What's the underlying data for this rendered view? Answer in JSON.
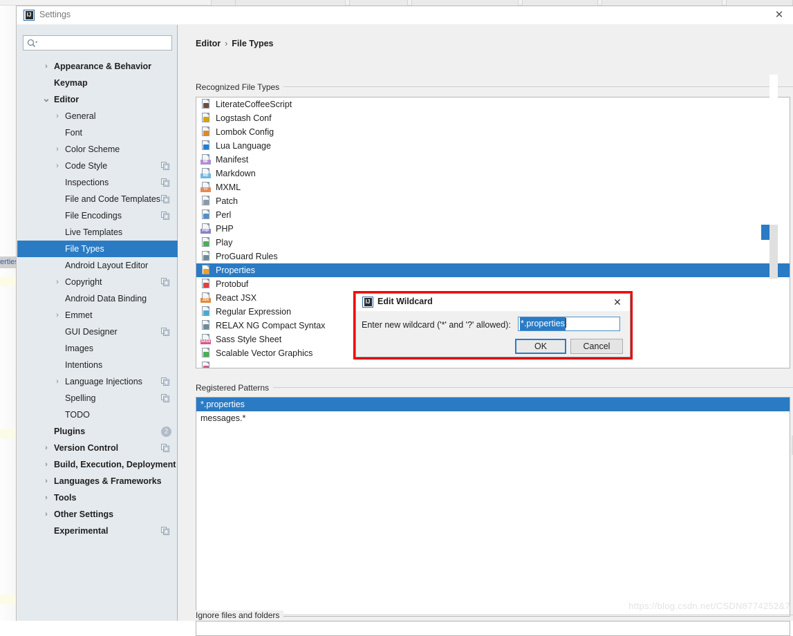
{
  "window": {
    "title": "Settings",
    "app_icon": "intellij-idea-icon",
    "close_label": "✕"
  },
  "background": {
    "editor_breadcrumb_fragment": "erties"
  },
  "sidebar": {
    "search": {
      "value": "",
      "placeholder": ""
    },
    "items": [
      {
        "label": "Appearance & Behavior",
        "indent": 0,
        "arrow": "collapsed",
        "bold": true,
        "copy": false,
        "badge": null,
        "selected": false
      },
      {
        "label": "Keymap",
        "indent": 0,
        "arrow": "none",
        "bold": true,
        "copy": false,
        "badge": null,
        "selected": false
      },
      {
        "label": "Editor",
        "indent": 0,
        "arrow": "expanded",
        "bold": true,
        "copy": false,
        "badge": null,
        "selected": false
      },
      {
        "label": "General",
        "indent": 1,
        "arrow": "collapsed",
        "bold": false,
        "copy": false,
        "badge": null,
        "selected": false
      },
      {
        "label": "Font",
        "indent": 1,
        "arrow": "none",
        "bold": false,
        "copy": false,
        "badge": null,
        "selected": false
      },
      {
        "label": "Color Scheme",
        "indent": 1,
        "arrow": "collapsed",
        "bold": false,
        "copy": false,
        "badge": null,
        "selected": false
      },
      {
        "label": "Code Style",
        "indent": 1,
        "arrow": "collapsed",
        "bold": false,
        "copy": true,
        "badge": null,
        "selected": false
      },
      {
        "label": "Inspections",
        "indent": 1,
        "arrow": "none",
        "bold": false,
        "copy": true,
        "badge": null,
        "selected": false
      },
      {
        "label": "File and Code Templates",
        "indent": 1,
        "arrow": "none",
        "bold": false,
        "copy": true,
        "badge": null,
        "selected": false
      },
      {
        "label": "File Encodings",
        "indent": 1,
        "arrow": "none",
        "bold": false,
        "copy": true,
        "badge": null,
        "selected": false
      },
      {
        "label": "Live Templates",
        "indent": 1,
        "arrow": "none",
        "bold": false,
        "copy": false,
        "badge": null,
        "selected": false
      },
      {
        "label": "File Types",
        "indent": 1,
        "arrow": "none",
        "bold": false,
        "copy": false,
        "badge": null,
        "selected": true
      },
      {
        "label": "Android Layout Editor",
        "indent": 1,
        "arrow": "none",
        "bold": false,
        "copy": false,
        "badge": null,
        "selected": false
      },
      {
        "label": "Copyright",
        "indent": 1,
        "arrow": "collapsed",
        "bold": false,
        "copy": true,
        "badge": null,
        "selected": false
      },
      {
        "label": "Android Data Binding",
        "indent": 1,
        "arrow": "none",
        "bold": false,
        "copy": false,
        "badge": null,
        "selected": false
      },
      {
        "label": "Emmet",
        "indent": 1,
        "arrow": "collapsed",
        "bold": false,
        "copy": false,
        "badge": null,
        "selected": false
      },
      {
        "label": "GUI Designer",
        "indent": 1,
        "arrow": "none",
        "bold": false,
        "copy": true,
        "badge": null,
        "selected": false
      },
      {
        "label": "Images",
        "indent": 1,
        "arrow": "none",
        "bold": false,
        "copy": false,
        "badge": null,
        "selected": false
      },
      {
        "label": "Intentions",
        "indent": 1,
        "arrow": "none",
        "bold": false,
        "copy": false,
        "badge": null,
        "selected": false
      },
      {
        "label": "Language Injections",
        "indent": 1,
        "arrow": "collapsed",
        "bold": false,
        "copy": true,
        "badge": null,
        "selected": false
      },
      {
        "label": "Spelling",
        "indent": 1,
        "arrow": "none",
        "bold": false,
        "copy": true,
        "badge": null,
        "selected": false
      },
      {
        "label": "TODO",
        "indent": 1,
        "arrow": "none",
        "bold": false,
        "copy": false,
        "badge": null,
        "selected": false
      },
      {
        "label": "Plugins",
        "indent": 0,
        "arrow": "none",
        "bold": true,
        "copy": false,
        "badge": "2",
        "selected": false
      },
      {
        "label": "Version Control",
        "indent": 0,
        "arrow": "collapsed",
        "bold": true,
        "copy": true,
        "badge": null,
        "selected": false
      },
      {
        "label": "Build, Execution, Deployment",
        "indent": 0,
        "arrow": "collapsed",
        "bold": true,
        "copy": false,
        "badge": null,
        "selected": false
      },
      {
        "label": "Languages & Frameworks",
        "indent": 0,
        "arrow": "collapsed",
        "bold": true,
        "copy": false,
        "badge": null,
        "selected": false
      },
      {
        "label": "Tools",
        "indent": 0,
        "arrow": "collapsed",
        "bold": true,
        "copy": false,
        "badge": null,
        "selected": false
      },
      {
        "label": "Other Settings",
        "indent": 0,
        "arrow": "collapsed",
        "bold": true,
        "copy": false,
        "badge": null,
        "selected": false
      },
      {
        "label": "Experimental",
        "indent": 0,
        "arrow": "none",
        "bold": true,
        "copy": true,
        "badge": null,
        "selected": false
      }
    ]
  },
  "main": {
    "breadcrumb": {
      "root": "Editor",
      "separator": "›",
      "leaf": "File Types"
    },
    "recognized_label": "Recognized File Types",
    "registered_label": "Registered Patterns",
    "ignore_label": "Ignore files and folders",
    "file_types": [
      {
        "label": "LiterateCoffeeScript",
        "icon": "coffeescript-file-icon",
        "tag": "",
        "tag_color": "#6f4e37",
        "selected": false
      },
      {
        "label": "Logstash Conf",
        "icon": "logstash-file-icon",
        "tag": "",
        "tag_color": "#d6a500",
        "selected": false
      },
      {
        "label": "Lombok Config",
        "icon": "lombok-file-icon",
        "tag": "",
        "tag_color": "#e08a1e",
        "selected": false
      },
      {
        "label": "Lua Language",
        "icon": "lua-file-icon",
        "tag": "",
        "tag_color": "#1d7fd6",
        "selected": false
      },
      {
        "label": "Manifest",
        "icon": "manifest-file-icon",
        "tag": "MF",
        "tag_color": "#b08fd0",
        "selected": false
      },
      {
        "label": "Markdown",
        "icon": "markdown-file-icon",
        "tag": "MD",
        "tag_color": "#6fb7e0",
        "selected": false
      },
      {
        "label": "MXML",
        "icon": "mxml-file-icon",
        "tag": "<>",
        "tag_color": "#e08a5e",
        "selected": false
      },
      {
        "label": "Patch",
        "icon": "patch-file-icon",
        "tag": "",
        "tag_color": "#8c9aa8",
        "selected": false
      },
      {
        "label": "Perl",
        "icon": "perl-file-icon",
        "tag": "",
        "tag_color": "#4f8fcb",
        "selected": false
      },
      {
        "label": "PHP",
        "icon": "php-file-icon",
        "tag": "PHP",
        "tag_color": "#8b7fc0",
        "selected": false
      },
      {
        "label": "Play",
        "icon": "play-file-icon",
        "tag": "",
        "tag_color": "#4caf50",
        "selected": false
      },
      {
        "label": "ProGuard Rules",
        "icon": "proguard-file-icon",
        "tag": "",
        "tag_color": "#6d8a99",
        "selected": false
      },
      {
        "label": "Properties",
        "icon": "properties-file-icon",
        "tag": "",
        "tag_color": "#f0a020",
        "selected": true
      },
      {
        "label": "Protobuf",
        "icon": "protobuf-file-icon",
        "tag": "",
        "tag_color": "#e04040",
        "selected": false
      },
      {
        "label": "React JSX",
        "icon": "react-jsx-file-icon",
        "tag": "JSX",
        "tag_color": "#e08a3e",
        "selected": false
      },
      {
        "label": "Regular Expression",
        "icon": "regex-file-icon",
        "tag": "",
        "tag_color": "#4aa8d8",
        "selected": false
      },
      {
        "label": "RELAX NG Compact Syntax",
        "icon": "relaxng-file-icon",
        "tag": "",
        "tag_color": "#6d8a99",
        "selected": false
      },
      {
        "label": "Sass Style Sheet",
        "icon": "sass-file-icon",
        "tag": "SASS",
        "tag_color": "#d35a8a",
        "selected": false
      },
      {
        "label": "Scalable Vector Graphics",
        "icon": "svg-file-icon",
        "tag": "",
        "tag_color": "#4caf50",
        "selected": false
      },
      {
        "label": "",
        "icon": "scss-file-icon",
        "tag": "",
        "tag_color": "#d35a8a",
        "selected": false
      }
    ],
    "patterns": [
      {
        "label": "*.properties",
        "selected": true
      },
      {
        "label": "messages.*",
        "selected": false
      }
    ],
    "toolbar_top": [
      {
        "icon": "plus-icon",
        "glyph": "+",
        "active": false
      },
      {
        "icon": "minus-icon",
        "glyph": "−",
        "active": false
      },
      {
        "icon": "pencil-icon",
        "glyph": "✎",
        "active": false
      }
    ],
    "toolbar_bottom": [
      {
        "icon": "plus-icon",
        "glyph": "+",
        "active": false
      },
      {
        "icon": "minus-icon",
        "glyph": "−",
        "active": false
      },
      {
        "icon": "pencil-icon",
        "glyph": "✎",
        "active": true
      }
    ]
  },
  "dialog": {
    "title": "Edit Wildcard",
    "icon": "intellij-idea-icon",
    "close_label": "✕",
    "prompt": "Enter new wildcard ('*' and '?' allowed):",
    "input_value": "*.properties",
    "ok_label": "OK",
    "cancel_label": "Cancel",
    "outline_color": "#fe0000"
  },
  "watermark": "https://blog.csdn.net/CSDN8774252&7",
  "colors": {
    "selection_blue": "#2a7bc4",
    "sidebar_bg": "#e5eaee",
    "panel_bg": "#f0f0f0",
    "highlight_red": "#fe0000"
  }
}
